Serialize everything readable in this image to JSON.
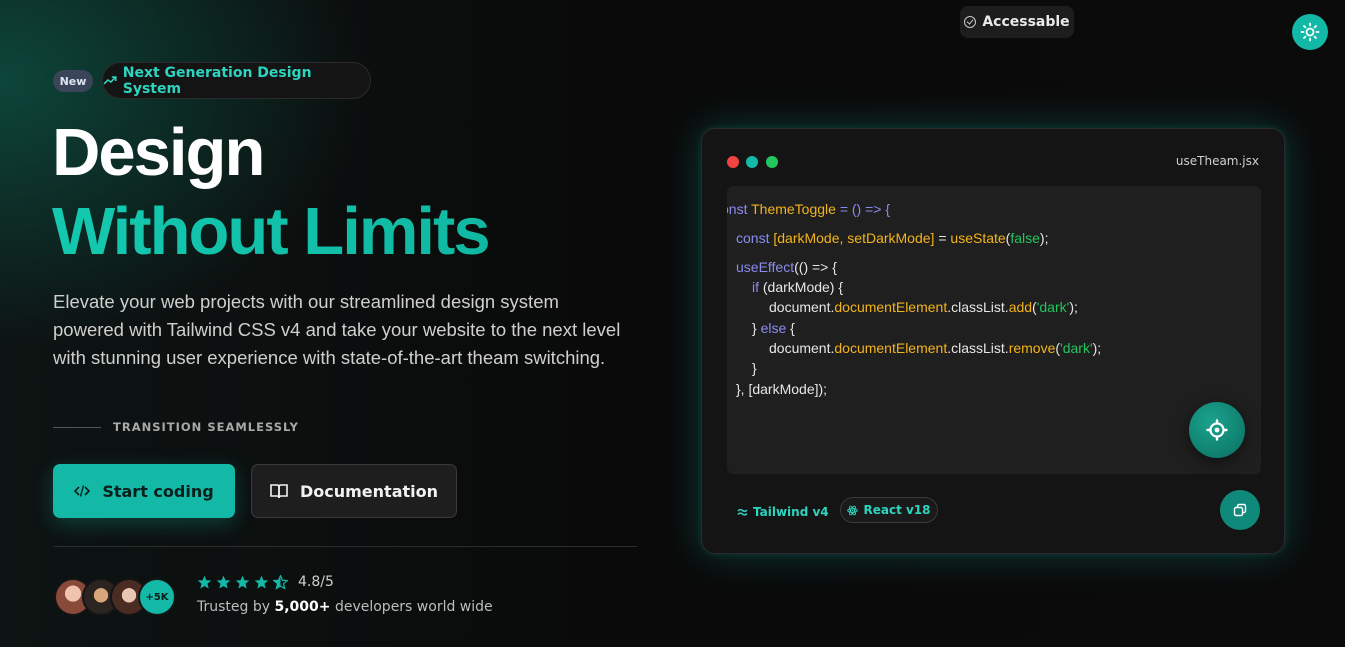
{
  "topbar": {
    "accessible_label": "Accessable",
    "theme_toggle_icon": "sun-icon"
  },
  "hero": {
    "new_badge": "New",
    "pill_label": "Next Generation Design System",
    "title_line1": "Design",
    "title_line2": "Without Limits",
    "lead": "Elevate your web projects with our streamlined design system powered with Tailwind CSS v4 and take your website to the next level with stunning user experience with state-of-the-art theam switching.",
    "transition_label": "TRANSITION SEAMLESSLY",
    "start_button": "Start coding",
    "doc_button": "Documentation",
    "avatars_more": "+5K",
    "rating": "4.8/5",
    "rating_stars": 4.5,
    "trust_prefix": "Trusteg by ",
    "trust_count": "5,000+",
    "trust_suffix": " developers world wide"
  },
  "code_window": {
    "filename": "useTheam.jsx",
    "tags": [
      "Tailwind v4",
      "React v18"
    ]
  },
  "colors": {
    "accent": "#14b8a6",
    "keyword": "#8b8cf0",
    "function": "#f3b41b",
    "string": "#22c55e"
  }
}
